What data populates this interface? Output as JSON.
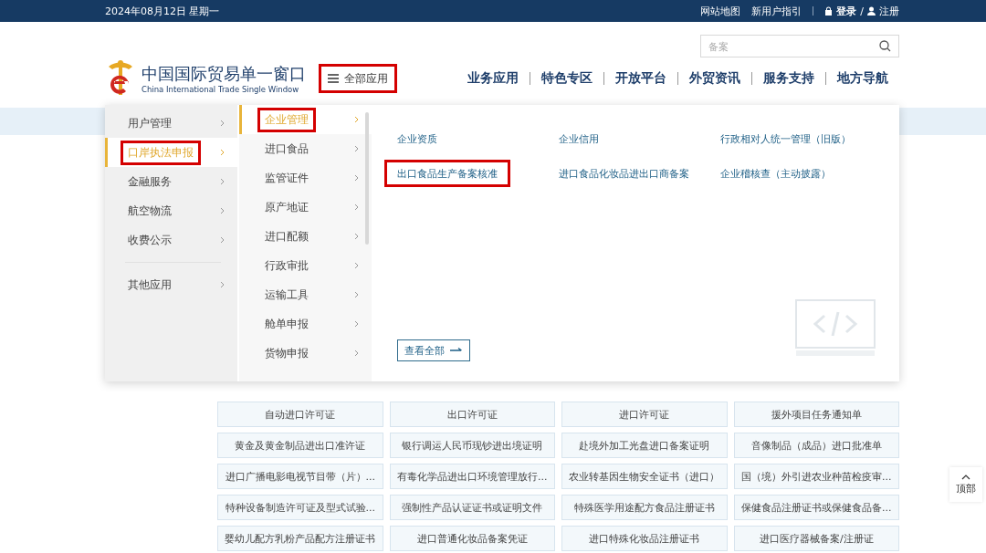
{
  "top_bar": {
    "date": "2024年08月12日 星期一",
    "links": [
      "网站地图",
      "新用户指引"
    ],
    "login": "登录",
    "separator": "/",
    "register": "注册"
  },
  "header": {
    "logo_title": "中国国际贸易单一窗口",
    "logo_subtitle": "China International Trade Single Window",
    "all_apps": {
      "label": "全部应用",
      "highlighted": true
    },
    "search": {
      "placeholder": "备案"
    },
    "nav": [
      "业务应用",
      "特色专区",
      "开放平台",
      "外贸资讯",
      "服务支持",
      "地方导航"
    ]
  },
  "menu": {
    "category_groups": [
      {
        "items": [
          {
            "label": "用户管理",
            "selected": false,
            "highlighted": false
          },
          {
            "label": "口岸执法申报",
            "selected": true,
            "highlighted": true
          },
          {
            "label": "金融服务",
            "selected": false,
            "highlighted": false
          },
          {
            "label": "航空物流",
            "selected": false,
            "highlighted": false
          },
          {
            "label": "收费公示",
            "selected": false,
            "highlighted": false
          }
        ]
      },
      {
        "items": [
          {
            "label": "其他应用",
            "selected": false,
            "highlighted": false
          }
        ]
      }
    ],
    "subcategories": [
      {
        "label": "企业管理",
        "selected": true,
        "highlighted": true
      },
      {
        "label": "进口食品",
        "selected": false,
        "highlighted": false
      },
      {
        "label": "监管证件",
        "selected": false,
        "highlighted": false
      },
      {
        "label": "原产地证",
        "selected": false,
        "highlighted": false
      },
      {
        "label": "进口配额",
        "selected": false,
        "highlighted": false
      },
      {
        "label": "行政审批",
        "selected": false,
        "highlighted": false
      },
      {
        "label": "运输工具",
        "selected": false,
        "highlighted": false
      },
      {
        "label": "舱单申报",
        "selected": false,
        "highlighted": false
      },
      {
        "label": "货物申报",
        "selected": false,
        "highlighted": false
      }
    ],
    "links": [
      {
        "label": "企业资质",
        "highlighted": false
      },
      {
        "label": "企业信用",
        "highlighted": false
      },
      {
        "label": "行政相对人统一管理（旧版）",
        "highlighted": false
      },
      {
        "label": "出口食品生产备案核准",
        "highlighted": true
      },
      {
        "label": "进口食品化妆品进出口商备案",
        "highlighted": false
      },
      {
        "label": "企业稽核查（主动披露）",
        "highlighted": false
      }
    ],
    "view_all": "查看全部"
  },
  "cards": [
    "自动进口许可证",
    "出口许可证",
    "进口许可证",
    "援外项目任务通知单",
    "黄金及黄金制品进出口准许证",
    "银行调运人民币现钞进出境证明",
    "赴境外加工光盘进口备案证明",
    "音像制品（成品）进口批准单",
    "进口广播电影电视节目带（片）...",
    "有毒化学品进出口环境管理放行...",
    "农业转基因生物安全证书（进口）",
    "国（境）外引进农业种苗检疫审...",
    "特种设备制造许可证及型式试验...",
    "强制性产品认证证书或证明文件",
    "特殊医学用途配方食品注册证书",
    "保健食品注册证书或保健食品备...",
    "婴幼儿配方乳粉产品配方注册证书",
    "进口普通化妆品备案凭证",
    "进口特殊化妆品注册证书",
    "进口医疗器械备案/注册证"
  ],
  "back_to_top": "顶部"
}
